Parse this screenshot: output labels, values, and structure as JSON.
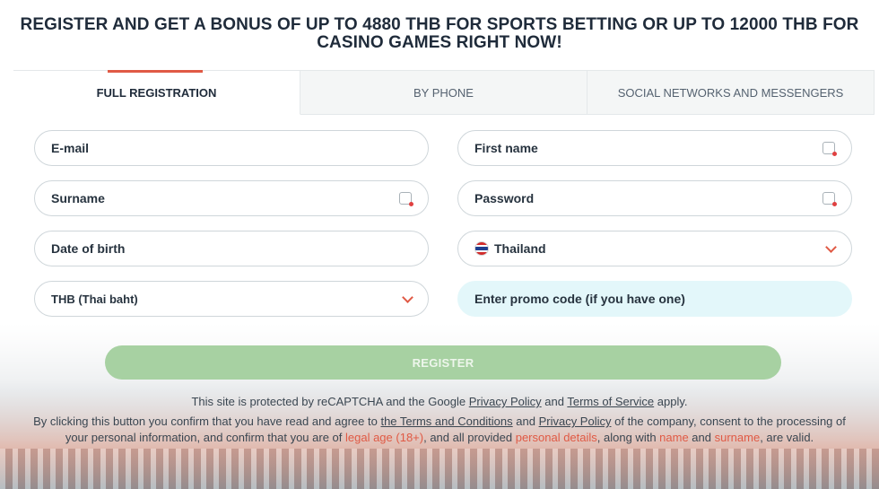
{
  "headline": "REGISTER AND GET A BONUS OF UP TO 4880 THB FOR SPORTS BETTING OR UP TO 12000 THB FOR CASINO GAMES RIGHT NOW!",
  "tabs": [
    {
      "label": "FULL REGISTRATION",
      "active": true
    },
    {
      "label": "BY PHONE",
      "active": false
    },
    {
      "label": "SOCIAL NETWORKS AND MESSENGERS",
      "active": false
    }
  ],
  "fields": {
    "email": "E-mail",
    "first_name": "First name",
    "surname": "Surname",
    "password": "Password",
    "date_of_birth": "Date of birth",
    "country": "Thailand",
    "currency": "THB (Thai baht)",
    "promo": "Enter promo code (if you have one)"
  },
  "register_label": "REGISTER",
  "recaptcha": {
    "prefix": "This site is protected by reCAPTCHA and the Google ",
    "privacy": "Privacy Policy",
    "and": " and ",
    "terms": "Terms of Service",
    "suffix": " apply."
  },
  "consent": {
    "t1": "By clicking this button you confirm that you have read and agree to ",
    "terms_link": "the Terms and Conditions",
    "t2": " and ",
    "privacy_link": "Privacy Policy",
    "t3": " of the company, consent to the processing of your personal information, and confirm that you are of ",
    "legal_age": "legal age (18+)",
    "t4": ", and all provided ",
    "personal_details": "personal details",
    "t5": ", along with ",
    "name": "name",
    "t6": " and ",
    "surname": "surname",
    "t7": ", are valid."
  },
  "colors": {
    "accent": "#e05a45",
    "register_bg": "#a7d1a2",
    "promo_bg": "#e3f7fa"
  },
  "icons": [
    "key-icon",
    "chevron-down-icon",
    "thailand-flag-icon"
  ]
}
